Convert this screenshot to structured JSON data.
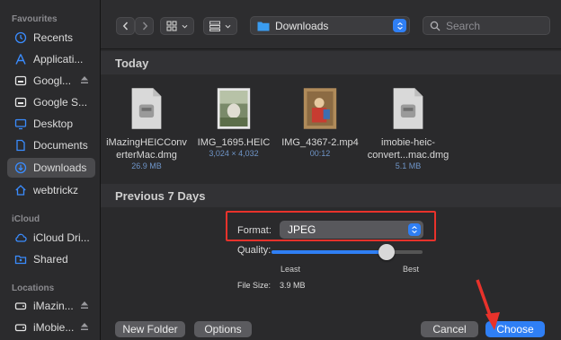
{
  "sidebar": {
    "favourites_title": "Favourites",
    "items": [
      {
        "label": "Recents",
        "icon": "clock-icon"
      },
      {
        "label": "Applicati...",
        "icon": "applications-icon"
      },
      {
        "label": "Googl...",
        "icon": "drive-icon"
      },
      {
        "label": "Google S...",
        "icon": "drive-icon"
      },
      {
        "label": "Desktop",
        "icon": "desktop-icon"
      },
      {
        "label": "Documents",
        "icon": "document-icon"
      },
      {
        "label": "Downloads",
        "icon": "download-icon"
      },
      {
        "label": "webtrickz",
        "icon": "home-icon"
      }
    ],
    "icloud_title": "iCloud",
    "icloud_items": [
      {
        "label": "iCloud Dri...",
        "icon": "cloud-icon"
      },
      {
        "label": "Shared",
        "icon": "shared-folder-icon"
      }
    ],
    "locations_title": "Locations",
    "location_items": [
      {
        "label": "iMazin...",
        "icon": "disk-icon"
      },
      {
        "label": "iMobie...",
        "icon": "disk-icon"
      }
    ]
  },
  "toolbar": {
    "location": "Downloads",
    "search_placeholder": "Search"
  },
  "sections": {
    "today": "Today",
    "previous": "Previous 7 Days"
  },
  "files": [
    {
      "name1": "iMazingHEICConv",
      "name2": "erterMac.dmg",
      "meta": "26.9 MB",
      "kind": "dmg"
    },
    {
      "name1": "IMG_1695.HEIC",
      "name2": "",
      "meta": "3,024 × 4,032",
      "kind": "image"
    },
    {
      "name1": "IMG_4367-2.mp4",
      "name2": "",
      "meta": "00:12",
      "kind": "video"
    },
    {
      "name1": "imobie-heic-",
      "name2": "convert...mac.dmg",
      "meta": "5.1 MB",
      "kind": "dmg"
    }
  ],
  "options": {
    "format_label": "Format:",
    "format_value": "JPEG",
    "quality_label": "Quality:",
    "quality_value": 0.76,
    "least_label": "Least",
    "best_label": "Best",
    "filesize_label": "File Size:",
    "filesize_value": "3.9 MB"
  },
  "buttons": {
    "new_folder": "New Folder",
    "options": "Options",
    "cancel": "Cancel",
    "choose": "Choose"
  },
  "colors": {
    "accent": "#2f7ff5",
    "highlight": "#e8322b"
  }
}
